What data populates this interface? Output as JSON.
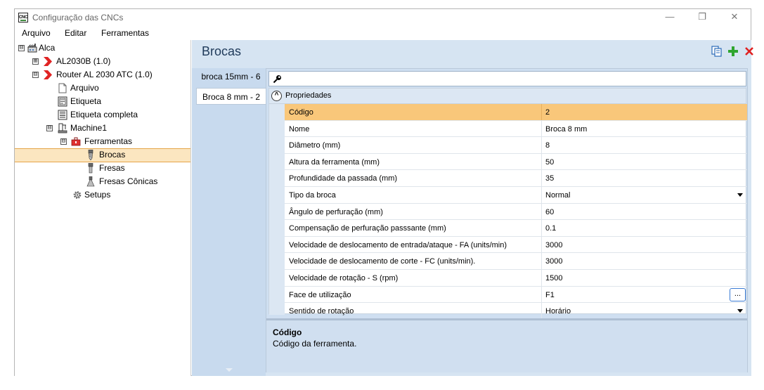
{
  "window": {
    "app_icon_text": "CNC",
    "title": "Configuração das CNCs",
    "controls": {
      "minimize": "—",
      "maximize": "❐",
      "close": "✕"
    }
  },
  "menu": [
    "Arquivo",
    "Editar",
    "Ferramentas"
  ],
  "tree": [
    {
      "label": "Alca",
      "expander": "⊟",
      "icon": "factory-icon"
    },
    {
      "label": "AL2030B (1.0)",
      "expander": "⊞",
      "icon": "red-chevron-icon"
    },
    {
      "label": "Router AL 2030 ATC (1.0)",
      "expander": "⊟",
      "icon": "red-chevron-icon"
    },
    {
      "label": "Arquivo",
      "icon": "document-icon"
    },
    {
      "label": "Etiqueta",
      "icon": "label-icon"
    },
    {
      "label": "Etiqueta completa",
      "icon": "full-label-icon"
    },
    {
      "label": "Machine1",
      "expander": "⊟",
      "icon": "machine-icon"
    },
    {
      "label": "Ferramentas",
      "expander": "⊟",
      "icon": "toolbox-icon"
    },
    {
      "label": "Brocas",
      "icon": "drill-bit-icon",
      "selected": true
    },
    {
      "label": "Fresas",
      "icon": "mill-icon"
    },
    {
      "label": "Fresas Cônicas",
      "icon": "conical-mill-icon"
    },
    {
      "label": "Setups",
      "icon": "gear-icon"
    }
  ],
  "panel": {
    "title": "Brocas",
    "tabs": [
      {
        "label": "broca 15mm - 6",
        "active": false
      },
      {
        "label": "Broca 8 mm - 2",
        "active": true
      }
    ],
    "search": {
      "value": "",
      "placeholder": ""
    },
    "category": {
      "toggle": "^",
      "label": "Propriedades"
    },
    "properties": [
      {
        "name": "Código",
        "value": "2",
        "selected": true
      },
      {
        "name": "Nome",
        "value": "Broca 8 mm"
      },
      {
        "name": "Diâmetro (mm)",
        "value": "8"
      },
      {
        "name": "Altura da ferramenta (mm)",
        "value": "50"
      },
      {
        "name": "Profundidade da passada (mm)",
        "value": "35"
      },
      {
        "name": "Tipo da broca",
        "value": "Normal",
        "editor": "dropdown"
      },
      {
        "name": "Ângulo de perfuração (mm)",
        "value": "60"
      },
      {
        "name": "Compensação de perfuração passsante (mm)",
        "value": "0.1"
      },
      {
        "name": "Velocidade de deslocamento de entrada/ataque - FA (units/min)",
        "value": "3000"
      },
      {
        "name": "Velocidade de deslocamento de corte - FC (units/min).",
        "value": "3000"
      },
      {
        "name": "Velocidade de rotação - S (rpm)",
        "value": "1500"
      },
      {
        "name": "Face de utilização",
        "value": "F1",
        "editor": "ellipsis",
        "button_label": "..."
      },
      {
        "name": "Sentido de rotação",
        "value": "Horário",
        "editor": "dropdown"
      }
    ],
    "description": {
      "title": "Código",
      "text": "Código da ferramenta."
    }
  },
  "colors": {
    "selection_orange": "#f9c77a",
    "tree_selection": "#fbe6c0",
    "panel_blue": "#d6e4f2",
    "add_green": "#2fa52f",
    "delete_red": "#e02020"
  }
}
